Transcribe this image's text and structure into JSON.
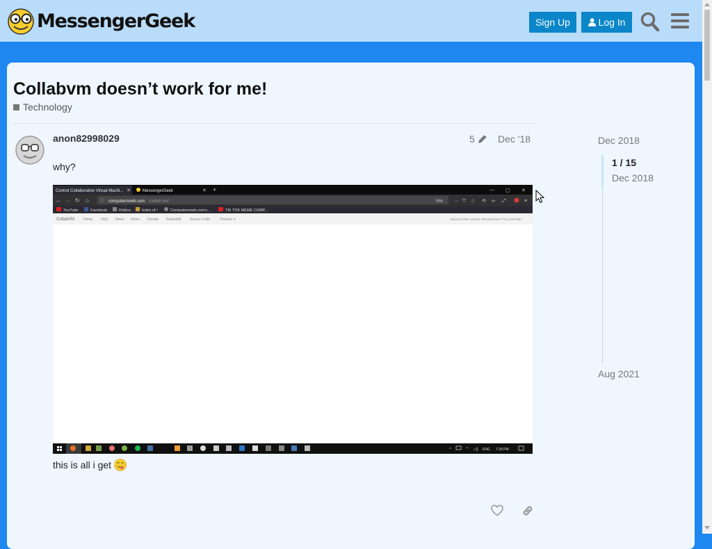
{
  "header": {
    "site_name": "MessengerGeek",
    "signup_label": "Sign Up",
    "login_label": "Log In"
  },
  "topic": {
    "title": "Collabvm doesn’t work for me!",
    "category": "Technology"
  },
  "post": {
    "username": "anon82998029",
    "edit_count": "5",
    "date": "Dec '18",
    "text_before": "why?",
    "text_after": "this is all i get"
  },
  "timeline": {
    "start_date": "Dec 2018",
    "position": "1 / 15",
    "position_date": "Dec 2018",
    "end_date": "Aug 2021"
  },
  "embedded_screenshot": {
    "tabs": [
      "Control Collaborative Virtual Machi...",
      "MessengerGeek"
    ],
    "url_host": "computernewb.com",
    "url_path": "/collab-vm/",
    "zoom": "70%",
    "bookmarks": [
      "YouTube",
      "Facebook",
      "Roblox",
      "Index of /",
      "Computernewb.com's...",
      "TIK TOK MEME COMP..."
    ],
    "site_brand": "CollabVM",
    "site_nav": [
      "Home",
      "FAQ",
      "News",
      "Rules",
      "Donate",
      "Subreddit",
      "Source Code",
      "Themes"
    ],
    "site_notice": "Bored of the current VM selection? Try UserVM!",
    "lang": "ENG",
    "clock": "7:28 PM"
  }
}
